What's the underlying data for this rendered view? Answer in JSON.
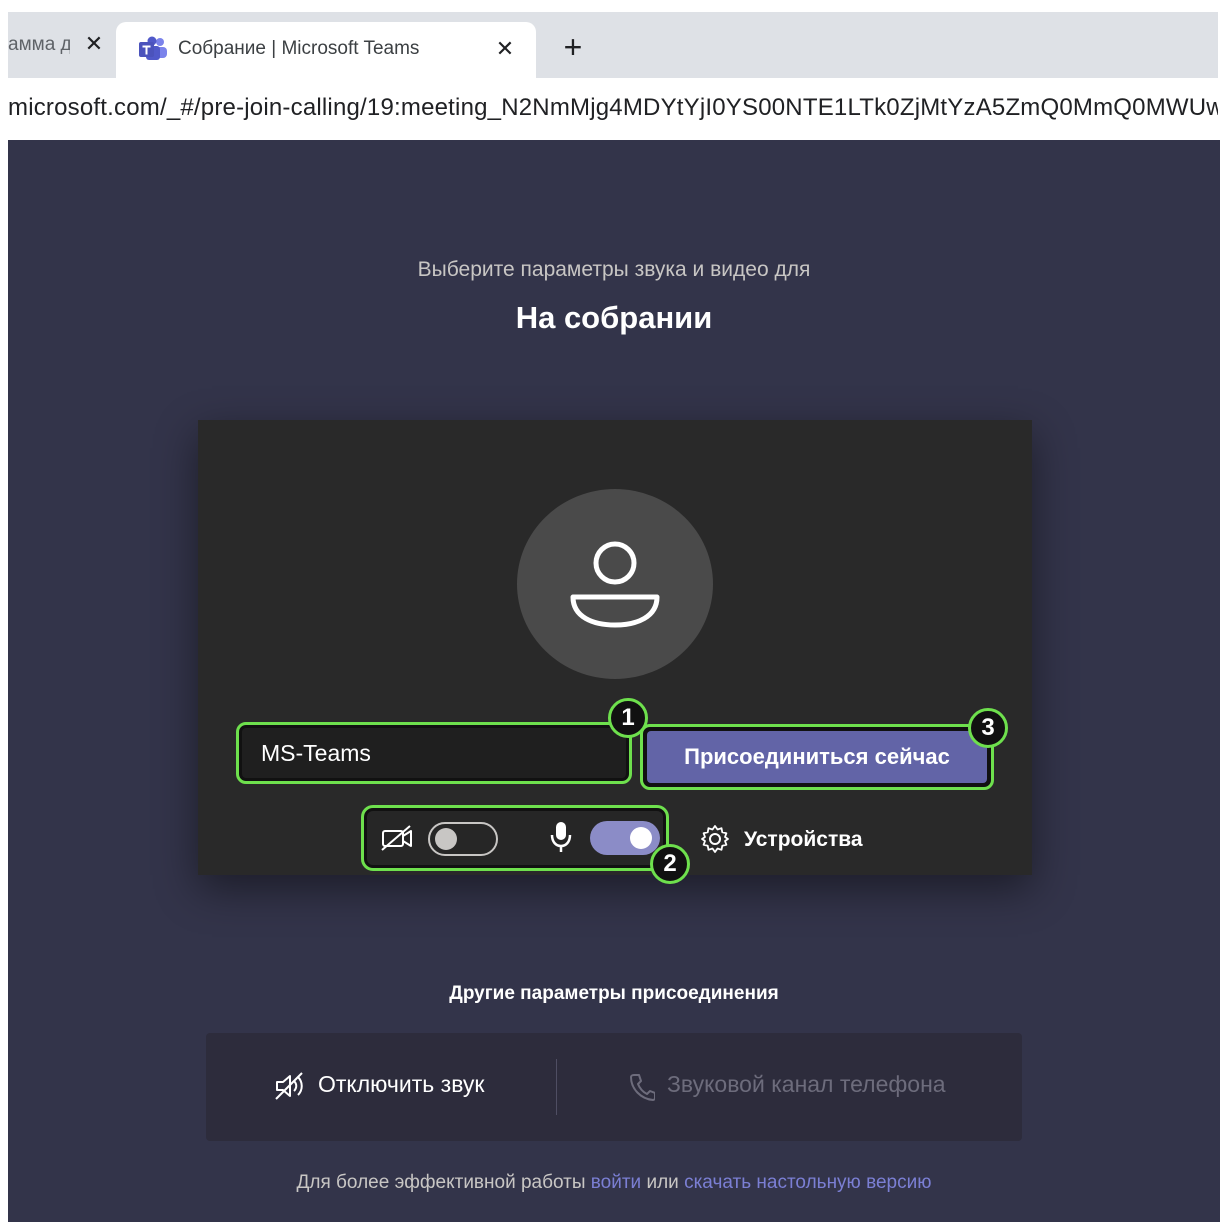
{
  "browser": {
    "prev_tab_title": "амма д",
    "active_tab_title": "Собрание | Microsoft Teams",
    "close_glyph": "✕",
    "new_tab_glyph": "+",
    "url": "microsoft.com/_#/pre-join-calling/19:meeting_N2NmMjg4MDYtYjI0YS00NTE1LTk0ZjMtYzA5ZmQ0MmQ0MWUw"
  },
  "prejoin": {
    "subtitle": "Выберите параметры звука и видео для",
    "title": "На собрании",
    "name_value": "MS-Teams",
    "join_label": "Присоединиться сейчас",
    "camera_on": false,
    "mic_on": true,
    "devices_label": "Устройства"
  },
  "annotations": {
    "badge1": "1",
    "badge2": "2",
    "badge3": "3"
  },
  "other_options": {
    "title": "Другие параметры присоединения",
    "mute_label": "Отключить звук",
    "phone_label": "Звуковой канал телефона"
  },
  "footer": {
    "prefix": "Для более эффективной работы",
    "login_link": "войти",
    "or": "или",
    "download_link": "скачать настольную версию"
  },
  "colors": {
    "accent": "#6264a7",
    "highlight": "#6ee04d",
    "page_bg": "#33344a",
    "card_bg": "#292929"
  }
}
